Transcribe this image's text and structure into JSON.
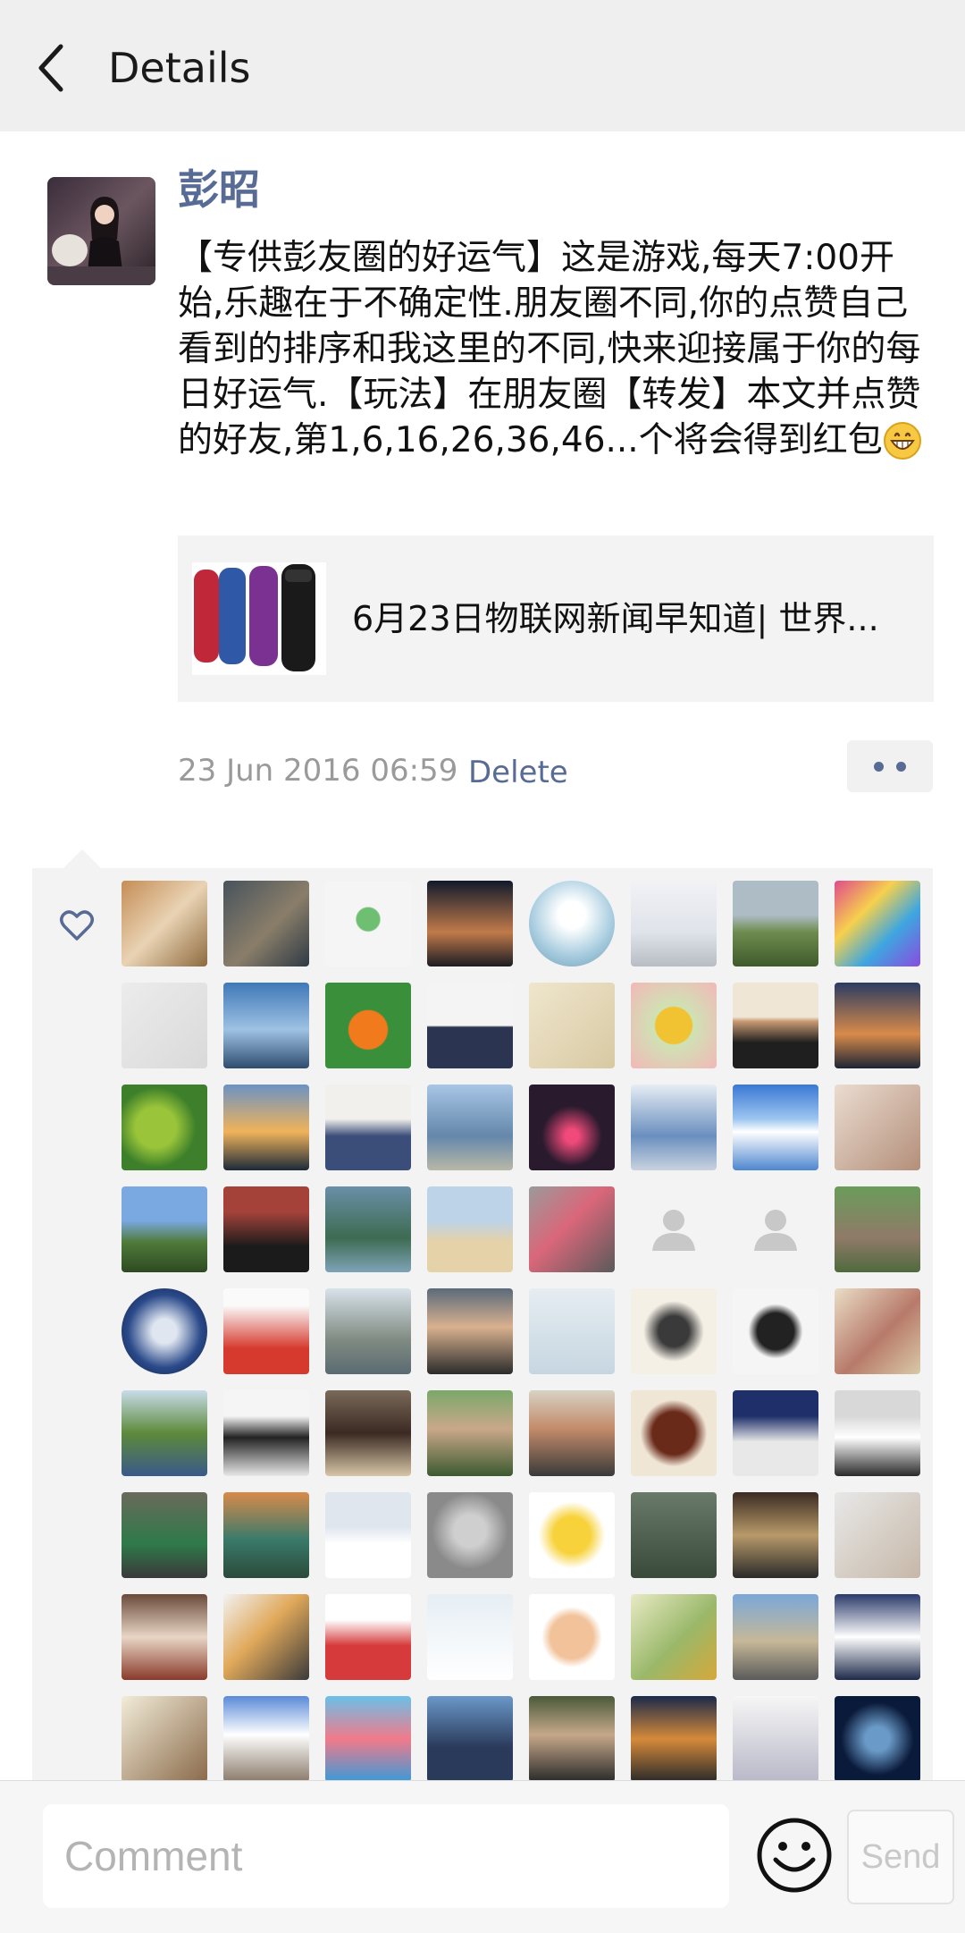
{
  "header": {
    "title": "Details"
  },
  "post": {
    "author": "彭昭",
    "text": "【专供彭友圈的好运气】这是游戏,每天7:00开始,乐趣在于不确定性.朋友圈不同,你的点赞自己看到的排序和我这里的不同,快来迎接属于你的每日好运气.【玩法】在朋友圈【转发】本文并点赞的好友,第1,6,16,26,36,46...个将会得到红包",
    "emoji": "grinning-face",
    "link_card": {
      "title": "6月23日物联网新闻早知道| 世界..."
    },
    "timestamp": "23 Jun 2016 06:59",
    "delete_label": "Delete"
  },
  "likes": {
    "avatars": [
      {
        "bg": "linear-gradient(135deg,#c58d55,#e9d3b4 50%,#8d6a3e)"
      },
      {
        "bg": "linear-gradient(135deg,#47535c,#8a7e6a 55%,#2f3a44)"
      },
      {
        "bg": "radial-gradient(circle at 50% 45%,#6fbf73 18%,#f5f5f5 20%)"
      },
      {
        "bg": "linear-gradient(180deg,#111a2b,#c07a4a 60%,#1c1c24)"
      },
      {
        "bg": "radial-gradient(circle at 50% 40%,#ffffff 20%,#a9cde0 60%,#6b9bb5)",
        "round": true
      },
      {
        "bg": "linear-gradient(180deg,#f2f2f6,#dfe3ea 60%,#b8bcc4)"
      },
      {
        "bg": "linear-gradient(180deg,#aebcc6 40%,#6e8c4e 60%,#3e5a2b)"
      },
      {
        "bg": "linear-gradient(135deg,#e04b8c,#f6d04d 35%,#3ea6e0 65%,#8a4be0)"
      },
      {
        "bg": "linear-gradient(135deg,#ececec,#d9d9d9)"
      },
      {
        "bg": "linear-gradient(180deg,#3f78b8,#9ec2e3 55%,#2e4c6e)"
      },
      {
        "bg": "radial-gradient(circle at 50% 55%,#f07a1c 30%,#3a8f3a 32%)"
      },
      {
        "bg": "linear-gradient(180deg,#f4f4f4 50%,#2b3552 52%)"
      },
      {
        "bg": "linear-gradient(135deg,#efe6cd,#d8c9a2)"
      },
      {
        "bg": "radial-gradient(circle at 50% 50%,#f1c232 30%,#cfe2b4 32%,#f2b8b8)"
      },
      {
        "bg": "linear-gradient(180deg,#f0e6d6 40%,#c89b72 45%,#1f1f1f 70%)"
      },
      {
        "bg": "linear-gradient(180deg,#2b3c63,#d88a4a 60%,#1d2536)"
      },
      {
        "bg": "radial-gradient(circle at 40% 50%,#9ac53a 30%,#3d7f2a 60%)"
      },
      {
        "bg": "linear-gradient(180deg,#6c92c4,#f0b35a 55%,#1d2a3a)"
      },
      {
        "bg": "linear-gradient(180deg,#f2f0ec 40%,#3b4e7a 60%)"
      },
      {
        "bg": "linear-gradient(180deg,#a8c6e6,#6487aa 60%,#b8b8a8)"
      },
      {
        "bg": "radial-gradient(circle at 50% 60%,#f04a7a 10%,#2a1a2e 45%)"
      },
      {
        "bg": "linear-gradient(180deg,#e6edf4,#6a8fbf 60%,#c9d3df)"
      },
      {
        "bg": "linear-gradient(180deg,#3a78d4,#9cc5f0 40%,#ffffff 55%,#4e86cf)"
      },
      {
        "bg": "linear-gradient(135deg,#eadcd0,#b48f7a)"
      },
      {
        "bg": "linear-gradient(180deg,#7aa8e0 40%,#4f7a3a 65%,#2e4a22)"
      },
      {
        "bg": "linear-gradient(180deg,#a4423a 30%,#1b1b1b 70%)"
      },
      {
        "bg": "linear-gradient(180deg,#6a8fa8,#3d6b52 60%,#7fa3b8)"
      },
      {
        "bg": "linear-gradient(180deg,#bcd3e8 40%,#e6d2a8 65%)"
      },
      {
        "bg": "linear-gradient(135deg,#9a9a9a,#d9677a 45%,#5a5a5a)"
      },
      {
        "blank": true
      },
      {
        "blank": true
      },
      {
        "bg": "linear-gradient(180deg,#6a9c5a,#8f7a68 60%,#4f6a3e)"
      },
      {
        "bg": "radial-gradient(circle at 50% 50%,#e0e6f0 20%,#2b4a8a 60%,#0e1a3a)",
        "round": true
      },
      {
        "bg": "linear-gradient(180deg,#fafafa 20%,#d63a2e 70%)"
      },
      {
        "bg": "linear-gradient(180deg,#d8e2ea,#7f8b82 60%,#5a6a72)"
      },
      {
        "bg": "linear-gradient(180deg,#5a6a7a,#d9b18f 45%,#2b2b2b)"
      },
      {
        "bg": "linear-gradient(180deg,#e6edf2,#c6d6e0)"
      },
      {
        "bg": "radial-gradient(circle at 50% 50%,#3a3a3a 25%,#f5f0e6 50%)"
      },
      {
        "bg": "radial-gradient(circle at 50% 50%,#222 30%,#f5f5f5 45%)"
      },
      {
        "bg": "linear-gradient(135deg,#e9ddc6,#b87a6a 55%,#d9c9a8)"
      },
      {
        "bg": "linear-gradient(180deg,#c8dcea,#5d8a3a 50%,#3a5a8a)"
      },
      {
        "bg": "linear-gradient(180deg,#f5f5f5 30%,#222 55%,#e8e8e8)"
      },
      {
        "bg": "linear-gradient(180deg,#7a6a5a,#3a2a22 50%,#d8c6a8)"
      },
      {
        "bg": "linear-gradient(180deg,#7aa86a,#c9a88a 45%,#3d5a30)"
      },
      {
        "bg": "linear-gradient(180deg,#d8d2c4,#c28a6a 45%,#3a3a3a)"
      },
      {
        "bg": "radial-gradient(circle at 50% 50%,#6a2a1a 35%,#f0e6d6 55%)"
      },
      {
        "bg": "linear-gradient(180deg,#1e2f6a 30%,#e8e8e8 60%)"
      },
      {
        "bg": "linear-gradient(180deg,#d8d8d8 30%,#ffffff 55%,#2a2a2a)"
      },
      {
        "bg": "linear-gradient(180deg,#6a6a5a,#2e7a4a 60%,#3a3a3a)"
      },
      {
        "bg": "linear-gradient(180deg,#d88a4a,#3a7a6a 55%,#2a4a3a)"
      },
      {
        "bg": "linear-gradient(180deg,#dfe6ee 40%,#ffffff 60%)"
      },
      {
        "bg": "radial-gradient(circle at 50% 45%,#cfcfcf 25%,#8a8a8a 60%)"
      },
      {
        "bg": "radial-gradient(circle at 50% 50%,#f7d23a 30%,#ffffff 55%)"
      },
      {
        "bg": "linear-gradient(180deg,#6a7a6a,#3a4a3a)"
      },
      {
        "bg": "linear-gradient(180deg,#3a2a22,#b89a6a 50%,#2a2a2a)"
      },
      {
        "bg": "linear-gradient(135deg,#e8e8e8,#c6b8a8)"
      },
      {
        "bg": "linear-gradient(180deg,#6a4a3a,#e8d6c6 50%,#8a3a2a)"
      },
      {
        "bg": "linear-gradient(135deg,#f2f2f2,#e0a85a 45%,#3a3a3a)"
      },
      {
        "bg": "linear-gradient(180deg,#ffffff 30%,#d63a3a 60%)"
      },
      {
        "bg": "linear-gradient(180deg,#e6eef4,#ffffff)"
      },
      {
        "bg": "radial-gradient(circle at 50% 50%,#f2c29a 35%,#ffffff 50%)"
      },
      {
        "bg": "linear-gradient(135deg,#e8eac4,#9ab86a 55%,#d6a83a)"
      },
      {
        "bg": "linear-gradient(180deg,#7aa8d8,#c6b898 55%,#5a5a5a)"
      },
      {
        "bg": "linear-gradient(180deg,#2a3a6a,#ffffff 50%,#1e2a4a)"
      },
      {
        "bg": "linear-gradient(135deg,#f2ecd8,#8a6a4a)"
      },
      {
        "bg": "linear-gradient(180deg,#5a8ad8,#ffffff 45%,#8a7a6a)"
      },
      {
        "bg": "linear-gradient(180deg,#6ac0e8,#f27a8a 50%,#3a9ad8)"
      },
      {
        "bg": "linear-gradient(180deg,#6a98c8,#2a3a5a 60%)"
      },
      {
        "bg": "linear-gradient(180deg,#4a5a3a,#c6a88a 45%,#2a2a2a)"
      },
      {
        "bg": "linear-gradient(180deg,#1a2a4a,#d68a3a 50%,#2a2a2a)"
      },
      {
        "bg": "linear-gradient(180deg,#f6f6f6,#b8b8c8)"
      },
      {
        "bg": "radial-gradient(circle at 50% 50%,#6a9ac8 20%,#0a1a3a 60%)"
      }
    ]
  },
  "comment_bar": {
    "placeholder": "Comment",
    "send_label": "Send"
  },
  "colors": {
    "link": "#576b95",
    "header_bg": "#efefef",
    "panel_bg": "#f3f3f3"
  },
  "icons": [
    "back-arrow-icon",
    "heart-icon",
    "grinning-face-emoji",
    "more-dots-icon",
    "smiley-icon",
    "default-avatar-icon"
  ]
}
